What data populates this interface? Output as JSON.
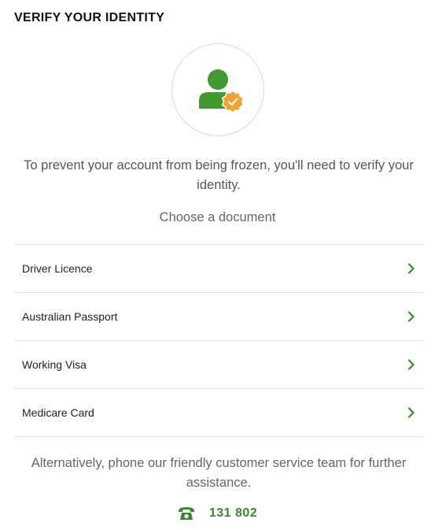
{
  "header": {
    "title": "VERIFY YOUR IDENTITY"
  },
  "badge": {
    "icon": "user-verified-icon",
    "user_color": "#3f9b2f",
    "check_color": "#f0a22e"
  },
  "intro": {
    "text": "To prevent your account from being frozen, you'll need to verify your identity.",
    "choose_label": "Choose a document"
  },
  "documents": [
    {
      "label": "Driver Licence"
    },
    {
      "label": "Australian Passport"
    },
    {
      "label": "Working Visa"
    },
    {
      "label": "Medicare Card"
    }
  ],
  "contact": {
    "text": "Alternatively, phone our friendly customer service team for further assistance.",
    "phone_icon": "phone-icon",
    "phone_number": "131 802"
  },
  "colors": {
    "accent": "#3a8a2c"
  }
}
